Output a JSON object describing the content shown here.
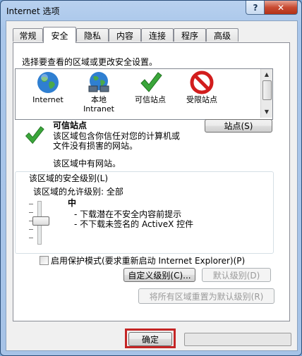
{
  "window": {
    "title": "Internet 选项",
    "help_label": "?",
    "close_label": "✕"
  },
  "tabs": [
    {
      "label": "常规"
    },
    {
      "label": "安全"
    },
    {
      "label": "隐私"
    },
    {
      "label": "内容"
    },
    {
      "label": "连接"
    },
    {
      "label": "程序"
    },
    {
      "label": "高级"
    }
  ],
  "security": {
    "select_zone_prompt": "选择要查看的区域或更改安全设置。",
    "zones": [
      {
        "label": "Internet",
        "icon": "globe-icon"
      },
      {
        "label": "本地\nIntranet",
        "icon": "intranet-globe-icon"
      },
      {
        "label": "可信站点",
        "icon": "checkmark-icon"
      },
      {
        "label": "受限站点",
        "icon": "no-entry-icon"
      }
    ],
    "selected_zone_title": "可信站点",
    "selected_zone_desc": "该区域包含你信任对您的计算机或\n文件没有损害的网站。",
    "sites_button": "站点(S)",
    "zone_has_sites": "该区域中有网站。",
    "level_group_label": "该区域的安全级别(L)",
    "allowed_levels": "该区域的允许级别: 全部",
    "level_name": "中",
    "level_bullets": [
      "- 下载潜在不安全内容前提示",
      "- 不下载未签名的 ActiveX 控件"
    ],
    "protected_mode": "启用保护模式(要求重新启动 Internet Explorer)(P)",
    "custom_level_button": "自定义级别(C)...",
    "default_level_button": "默认级别(D)",
    "reset_all_button": "将所有区域重置为默认级别(R)"
  },
  "footer": {
    "ok_button": "确定"
  },
  "colors": {
    "highlight": "#c42525",
    "title_bg": "#b8d1ef"
  }
}
